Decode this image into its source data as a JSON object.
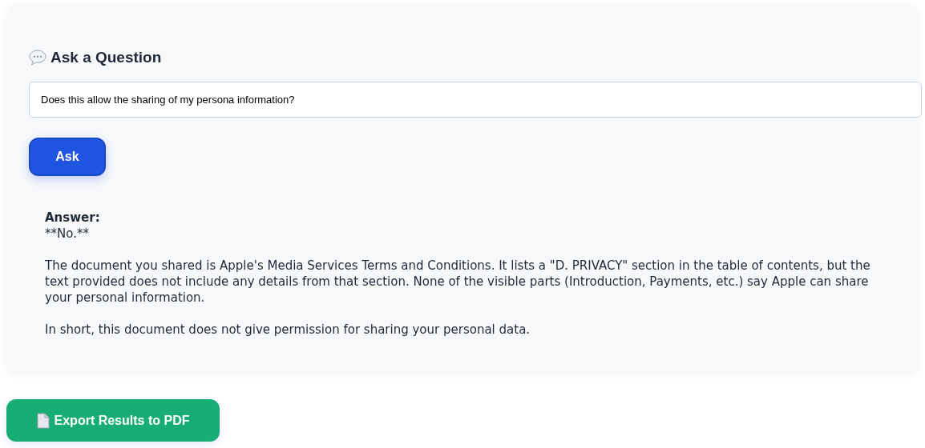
{
  "heading": "Ask a Question",
  "question_field": {
    "value": "Does this allow the sharing of my persona information?"
  },
  "ask_button": "Ask",
  "answer": {
    "label": "Answer:",
    "paragraphs": [
      "**No.**",
      "The document you shared is Apple's Media Services Terms and Conditions. It lists a \"D. PRIVACY\" section in the table of contents, but the text provided does not include any details from that section. None of the visible parts (Introduction, Payments, etc.) say Apple can share your personal information.",
      "In short, this document does not give permission for sharing your personal data."
    ]
  },
  "export_button": "Export Results to PDF"
}
